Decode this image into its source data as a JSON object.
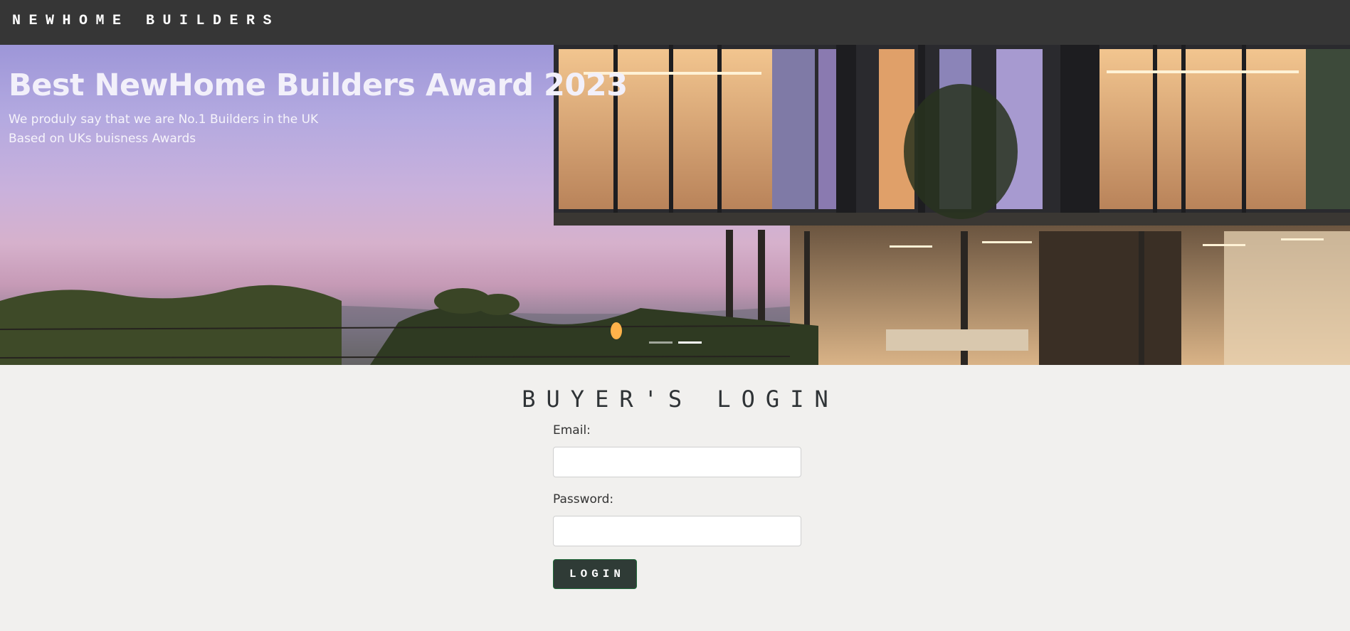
{
  "navbar": {
    "brand": "NEWHOME BUILDERS"
  },
  "hero": {
    "title": "Best NewHome Builders Award 2023",
    "subtitle_line1": "We produly say that we are No.1 Builders in the UK",
    "subtitle_line2": "Based on UKs buisness Awards",
    "slide_count": 2,
    "active_slide": 2
  },
  "login": {
    "title": "BUYER'S LOGIN",
    "email_label": "Email:",
    "email_value": "",
    "password_label": "Password:",
    "password_value": "",
    "button_label": "LOGIN"
  },
  "colors": {
    "navbar_bg": "#363636",
    "page_bg": "#f1f0ee",
    "button_bg": "#2f3b36",
    "button_border": "#1f6a3a"
  }
}
